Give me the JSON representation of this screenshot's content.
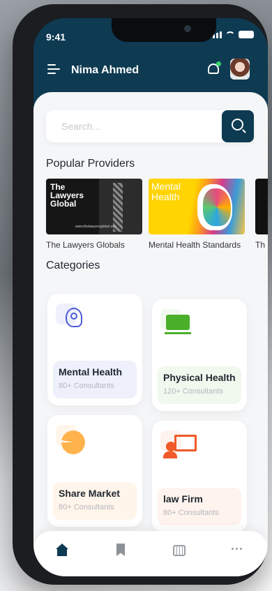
{
  "status_bar": {
    "time": "9:41"
  },
  "header": {
    "user_name": "Nima Ahmed",
    "has_notification": true
  },
  "search": {
    "placeholder": "Search..."
  },
  "popular_providers": {
    "title": "Popular Providers",
    "items": [
      {
        "caption": "The Lawyers Globals",
        "image_text": "The\nLawyers\nGlobal",
        "image_url_text": "www.thelawyersglobal.org"
      },
      {
        "caption": "Mental Health Standards",
        "image_text": "Mental\nHealth"
      },
      {
        "caption": "Th"
      }
    ]
  },
  "categories": {
    "title": "Categories",
    "items": [
      {
        "name": "Mental Health",
        "count": "80+ Consultants",
        "icon": "mental-health-icon",
        "accent": "#4d5ad8",
        "tint": "#eef0fb"
      },
      {
        "name": "Physical Health",
        "count": "120+ Consultants",
        "icon": "monitor-icon",
        "accent": "#4caf2a",
        "tint": "#f1f8ee"
      },
      {
        "name": "Share Market",
        "count": "80+ Consultants",
        "icon": "pie-chart-icon",
        "accent": "#ffb34d",
        "tint": "#fff5ea"
      },
      {
        "name": "law Firm",
        "count": "80+ Consultants",
        "icon": "presentation-icon",
        "accent": "#f05a28",
        "tint": "#fff3ed"
      }
    ]
  },
  "bottom_nav": {
    "items": [
      {
        "icon": "home-icon",
        "active": true
      },
      {
        "icon": "bookmark-icon",
        "active": false
      },
      {
        "icon": "calendar-icon",
        "active": false
      },
      {
        "icon": "more-icon",
        "active": false
      }
    ]
  },
  "colors": {
    "primary": "#0e3a52",
    "background": "#f5f6f8"
  }
}
